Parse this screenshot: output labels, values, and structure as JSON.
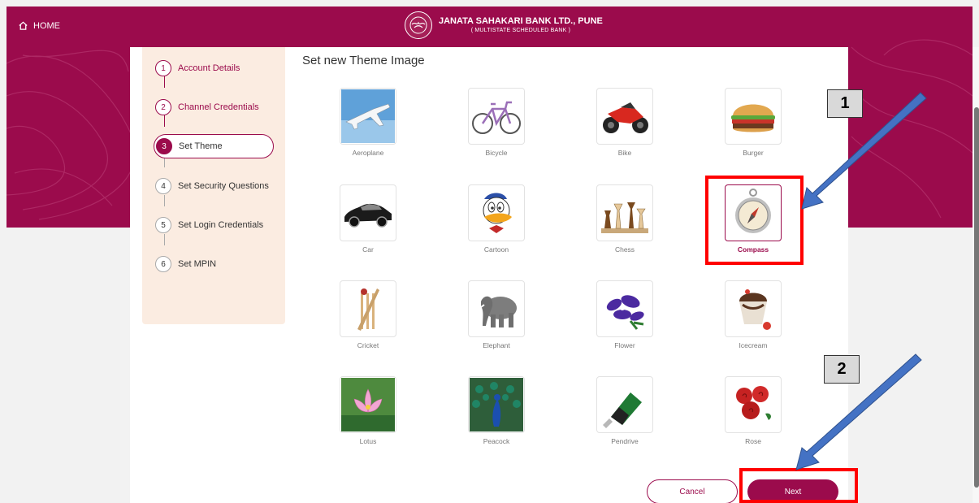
{
  "header": {
    "home_label": "HOME",
    "bank_name": "JANATA SAHAKARI BANK LTD., PUNE",
    "bank_subtitle": "( MULTISTATE SCHEDULED BANK )"
  },
  "stepper": {
    "steps": [
      {
        "num": "1",
        "label": "Account Details",
        "state": "done"
      },
      {
        "num": "2",
        "label": "Channel Credentials",
        "state": "done"
      },
      {
        "num": "3",
        "label": "Set Theme",
        "state": "active"
      },
      {
        "num": "4",
        "label": "Set Security Questions",
        "state": "pending"
      },
      {
        "num": "5",
        "label": "Set Login Credentials",
        "state": "pending"
      },
      {
        "num": "6",
        "label": "Set MPIN",
        "state": "pending"
      }
    ]
  },
  "main": {
    "title": "Set new Theme Image",
    "themes": [
      {
        "label": "Aeroplane",
        "icon": "aeroplane-image"
      },
      {
        "label": "Bicycle",
        "icon": "bicycle-image"
      },
      {
        "label": "Bike",
        "icon": "bike-image"
      },
      {
        "label": "Burger",
        "icon": "burger-image"
      },
      {
        "label": "Car",
        "icon": "car-image"
      },
      {
        "label": "Cartoon",
        "icon": "cartoon-image"
      },
      {
        "label": "Chess",
        "icon": "chess-image"
      },
      {
        "label": "Compass",
        "icon": "compass-image",
        "selected": true
      },
      {
        "label": "Cricket",
        "icon": "cricket-image"
      },
      {
        "label": "Elephant",
        "icon": "elephant-image"
      },
      {
        "label": "Flower",
        "icon": "flower-image"
      },
      {
        "label": "Icecream",
        "icon": "icecream-image"
      },
      {
        "label": "Lotus",
        "icon": "lotus-image"
      },
      {
        "label": "Peacock",
        "icon": "peacock-image"
      },
      {
        "label": "Pendrive",
        "icon": "pendrive-image"
      },
      {
        "label": "Rose",
        "icon": "rose-image"
      }
    ],
    "cancel_label": "Cancel",
    "next_label": "Next"
  },
  "annotations": {
    "callout_1": "1",
    "callout_2": "2"
  },
  "colors": {
    "brand": "#9b0b4c",
    "stepper_bg": "#fbece1",
    "highlight": "#ff0000",
    "arrow": "#4472c4"
  }
}
